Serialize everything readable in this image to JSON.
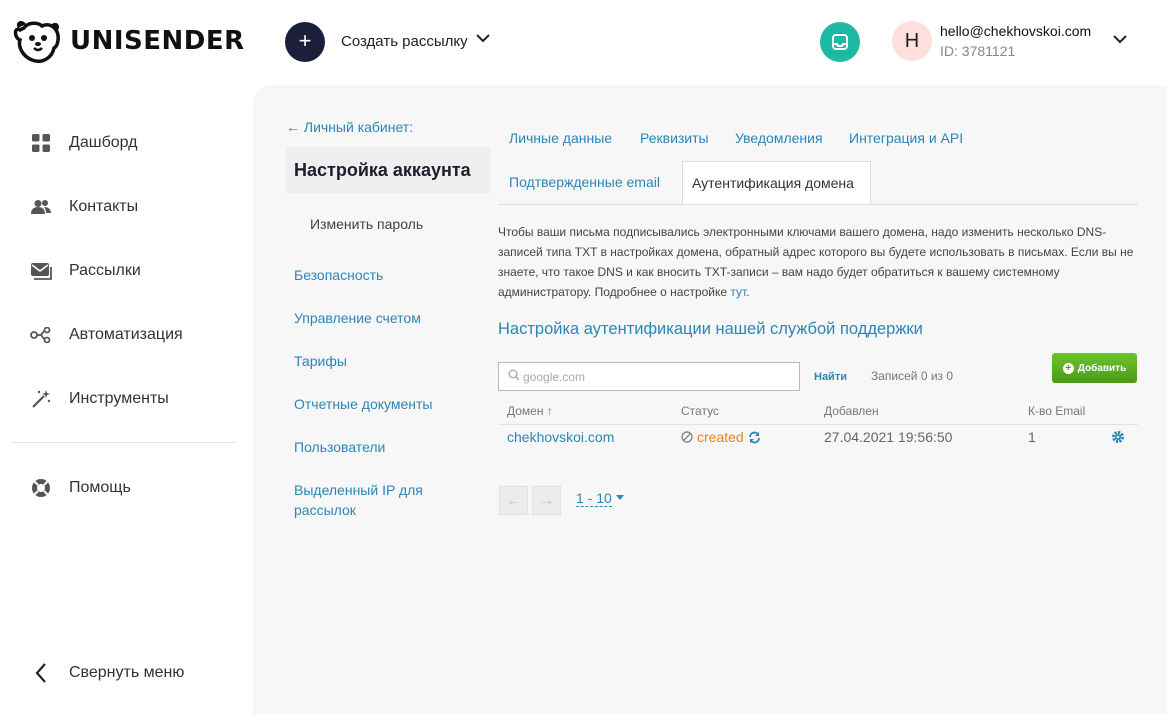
{
  "brand": {
    "name": "UNISENDER"
  },
  "header": {
    "create_label": "Создать рассылку",
    "create_icon": "plus-icon",
    "user_initial": "H",
    "user_email": "hello@chekhovskoi.com",
    "user_id": "ID: 3781121",
    "accent": "#1fb8a4"
  },
  "nav": {
    "items": [
      {
        "label": "Дашборд",
        "icon": "dashboard-icon"
      },
      {
        "label": "Контакты",
        "icon": "contacts-icon"
      },
      {
        "label": "Рассылки",
        "icon": "mail-icon"
      },
      {
        "label": "Автоматизация",
        "icon": "automation-icon"
      },
      {
        "label": "Инструменты",
        "icon": "magic-wand-icon"
      }
    ],
    "help": "Помощь",
    "collapse": "Свернуть меню"
  },
  "settings": {
    "back": "← Личный кабинет:",
    "title": "Настройка аккаунта",
    "change_password": "Изменить пароль",
    "links": [
      "Безопасность",
      "Управление счетом",
      "Тарифы",
      "Отчетные документы",
      "Пользователи",
      "Выделенный IP для рассылок"
    ]
  },
  "tabs": {
    "row1": [
      "Личные данные",
      "Реквизиты",
      "Уведомления",
      "Интеграция и API"
    ],
    "row2": [
      "Подтвержденные email",
      "Аутентификация домена"
    ]
  },
  "description": {
    "text": "Чтобы ваши письма подписывались электронными ключами вашего домена, надо изменить несколько DNS-записей типа TXT в настройках домена, обратный адрес которого вы будете использовать в письмах. Если вы не знаете, что такое DNS и как вносить TXT-записи – вам надо будет обратиться к вашему системному администратору. Подробнее о настройке",
    "link": "тут",
    "end": "."
  },
  "support_title": "Настройка аутентификации нашей службой поддержки",
  "search": {
    "placeholder": "google.com",
    "value": "",
    "find": "Найти",
    "records": "Записей 0 из 0"
  },
  "add_button": "Добавить",
  "table": {
    "headers": [
      "Домен ↑",
      "Статус",
      "Добавлен",
      "К-во Email"
    ],
    "rows": [
      {
        "domain": "chekhovskoi.com",
        "status": "created",
        "added": "27.04.2021 19:56:50",
        "count": "1"
      }
    ]
  },
  "pager": {
    "prev": "←",
    "next": "→",
    "size": "1 - 10"
  }
}
